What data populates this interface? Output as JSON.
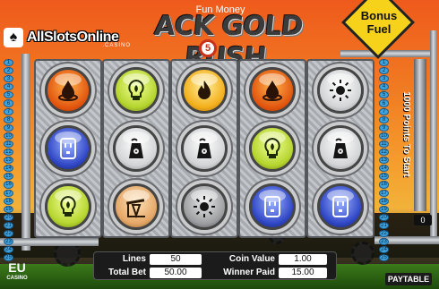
{
  "logo": {
    "text": "AllSlotsOnline",
    "suffix": ".CASINO"
  },
  "header": {
    "title": "ACK GOLD RUSH",
    "fun_money": "Fun Money",
    "active_lines_badge": "5"
  },
  "bonus": {
    "label_line1": "Bonus",
    "label_line2": "Fuel",
    "color": "#f6d21a"
  },
  "paylines": {
    "left": [
      "1",
      "2",
      "3",
      "4",
      "5",
      "6",
      "7",
      "8",
      "9",
      "10",
      "11",
      "12",
      "13",
      "14",
      "15",
      "16",
      "17",
      "18",
      "19",
      "20",
      "21",
      "22",
      "23",
      "24",
      "25"
    ],
    "right": [
      "1",
      "2",
      "3",
      "4",
      "5",
      "6",
      "7",
      "8",
      "9",
      "10",
      "11",
      "12",
      "13",
      "14",
      "15",
      "16",
      "17",
      "18",
      "19",
      "20",
      "21",
      "22",
      "23",
      "24",
      "25"
    ]
  },
  "reels": [
    [
      {
        "symbol": "oil-drop-icon",
        "color": "orange"
      },
      {
        "symbol": "power-outlet-icon",
        "color": "blue"
      },
      {
        "symbol": "light-bulb-icon",
        "color": "green"
      }
    ],
    [
      {
        "symbol": "light-bulb-icon",
        "color": "green"
      },
      {
        "symbol": "nuclear-plant-icon",
        "color": "white"
      },
      {
        "symbol": "oil-pump-icon",
        "color": "peach"
      }
    ],
    [
      {
        "symbol": "flame-icon",
        "color": "yellow"
      },
      {
        "symbol": "nuclear-plant-icon",
        "color": "white"
      },
      {
        "symbol": "sun-icon",
        "color": "grey"
      }
    ],
    [
      {
        "symbol": "oil-drop-icon",
        "color": "orange"
      },
      {
        "symbol": "light-bulb-icon",
        "color": "green"
      },
      {
        "symbol": "power-outlet-icon",
        "color": "blue"
      }
    ],
    [
      {
        "symbol": "sun-icon",
        "color": "white"
      },
      {
        "symbol": "nuclear-plant-icon",
        "color": "white"
      },
      {
        "symbol": "power-outlet-icon",
        "color": "blue"
      }
    ]
  ],
  "meter": {
    "label": "1000 Points To Start",
    "value": "0"
  },
  "info": {
    "lines_label": "Lines",
    "lines_value": "50",
    "coin_value_label": "Coin Value",
    "coin_value": "1.00",
    "total_bet_label": "Total Bet",
    "total_bet_value": "50.00",
    "winner_paid_label": "Winner Paid",
    "winner_paid_value": "15.00"
  },
  "footer": {
    "paytable": "PAYTABLE",
    "brand": "EU",
    "brand_sub": "CASINO"
  }
}
